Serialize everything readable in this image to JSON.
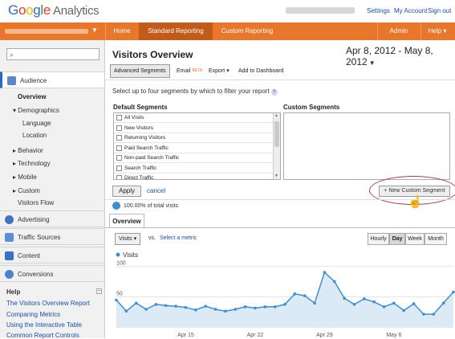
{
  "brand": {
    "google": "Google",
    "product": "Analytics"
  },
  "top_links": {
    "settings": "Settings",
    "my_account": "My Account",
    "sign_out": "Sign out"
  },
  "nav": {
    "home": "Home",
    "standard": "Standard Reporting",
    "custom": "Custom Reporting",
    "admin": "Admin",
    "help": "Help"
  },
  "colors": {
    "orange": "#e8772c",
    "orange_dark": "#c25a19",
    "link": "#1a4fa8",
    "chart_line": "#3c8fd0"
  },
  "sidebar": {
    "search_placeholder": "",
    "audience": "Audience",
    "overview": "Overview",
    "demographics": "Demographics",
    "language": "Language",
    "location": "Location",
    "behavior": "Behavior",
    "technology": "Technology",
    "mobile": "Mobile",
    "custom": "Custom",
    "visitors_flow": "Visitors Flow",
    "advertising": "Advertising",
    "traffic_sources": "Traffic Sources",
    "content": "Content",
    "conversions": "Conversions",
    "help_title": "Help",
    "help_links": [
      "The Visitors Overview Report",
      "Comparing Metrics",
      "Using the Interactive Table",
      "Common Report Controls"
    ]
  },
  "main": {
    "title": "Visitors Overview",
    "date_range": "Apr 8, 2012 - May 8, 2012",
    "toolbar": {
      "advanced_segments": "Advanced Segments",
      "email": "Email",
      "beta": "BETA",
      "export": "Export",
      "add_dashboard": "Add to Dashboard"
    },
    "segment_prompt": "Select up to four segments by which to filter your report",
    "default_segments_label": "Default Segments",
    "custom_segments_label": "Custom Segments",
    "default_segments": [
      "All Visits",
      "New Visitors",
      "Returning Visitors",
      "Paid Search Traffic",
      "Non-paid Search Traffic",
      "Search Traffic",
      "Direct Traffic"
    ],
    "apply": "Apply",
    "cancel": "cancel",
    "new_custom_segment": "+ New Custom Segment",
    "pct_of_total": "100.00% of total visits",
    "overview_tab": "Overview",
    "metric": "Visits",
    "vs": "vs.",
    "select_metric": "Select a metric",
    "granularity": [
      "Hourly",
      "Day",
      "Week",
      "Month"
    ],
    "granularity_active": "Day"
  },
  "chart_data": {
    "type": "area",
    "series": [
      {
        "name": "Visits",
        "values": [
          45,
          27,
          40,
          30,
          38,
          36,
          35,
          33,
          29,
          35,
          30,
          27,
          30,
          34,
          32,
          34,
          34,
          38,
          55,
          52,
          40,
          90,
          75,
          48,
          38,
          47,
          42,
          34,
          40,
          28,
          39,
          22,
          22,
          40,
          58
        ]
      }
    ],
    "ylim": [
      0,
      120
    ],
    "yticks": [
      50,
      100
    ],
    "x_tick_labels": [
      "Apr 15",
      "Apr 22",
      "Apr 29",
      "May 6"
    ],
    "grid": true
  }
}
